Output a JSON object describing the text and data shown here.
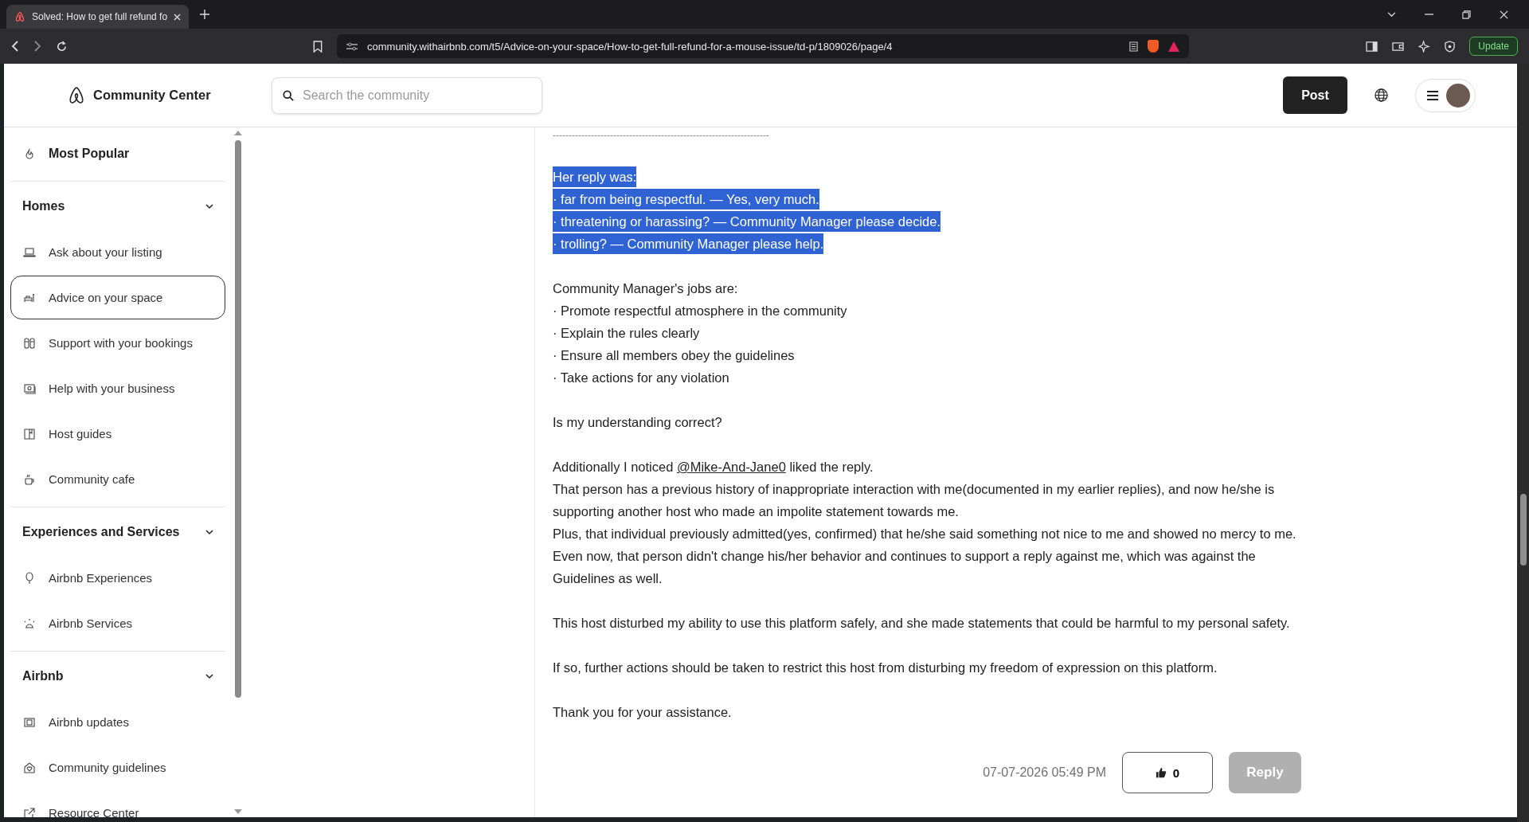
{
  "browser": {
    "tab_title": "Solved: How to get full refund fo",
    "url": "community.withairbnb.com/t5/Advice-on-your-space/How-to-get-full-refund-for-a-mouse-issue/td-p/1809026/page/4",
    "update_label": "Update"
  },
  "header": {
    "title": "Community Center",
    "search": {
      "placeholder": "Search the community"
    },
    "post_label": "Post"
  },
  "sidebar": {
    "items": [
      {
        "kind": "top-link",
        "label": "Most Popular",
        "selected": false
      },
      {
        "kind": "divider"
      },
      {
        "kind": "section",
        "label": "Homes",
        "expanded": true
      },
      {
        "kind": "link",
        "label": "Ask about your listing",
        "selected": false
      },
      {
        "kind": "link",
        "label": "Advice on your space",
        "selected": true
      },
      {
        "kind": "link",
        "label": "Support with your bookings",
        "selected": false
      },
      {
        "kind": "link",
        "label": "Help with your business",
        "selected": false
      },
      {
        "kind": "link",
        "label": "Host guides",
        "selected": false
      },
      {
        "kind": "link",
        "label": "Community cafe",
        "selected": false
      },
      {
        "kind": "divider"
      },
      {
        "kind": "section",
        "label": "Experiences and Services",
        "expanded": true
      },
      {
        "kind": "link",
        "label": "Airbnb Experiences",
        "selected": false
      },
      {
        "kind": "link",
        "label": "Airbnb Services",
        "selected": false
      },
      {
        "kind": "divider"
      },
      {
        "kind": "section",
        "label": "Airbnb",
        "expanded": true
      },
      {
        "kind": "link",
        "label": "Airbnb updates",
        "selected": false
      },
      {
        "kind": "link",
        "label": "Community guidelines",
        "selected": false
      },
      {
        "kind": "link",
        "label": "Resource Center",
        "selected": false
      }
    ]
  },
  "post": {
    "separator": "--------------------------------------------------------------------",
    "paragraphs": [
      {
        "selected": true,
        "lines": [
          [
            {
              "kind": "text",
              "text": "Her reply was:"
            }
          ],
          [
            {
              "kind": "text",
              "text": "· far from being respectful. — Yes, very much."
            }
          ],
          [
            {
              "kind": "text",
              "text": "· threatening or harassing? — Community Manager please decide."
            }
          ],
          [
            {
              "kind": "text",
              "text": "· trolling? — Community Manager please help."
            }
          ]
        ]
      },
      {
        "selected": false,
        "lines": [
          [
            {
              "kind": "text",
              "text": "Community Manager's jobs are:"
            }
          ],
          [
            {
              "kind": "text",
              "text": "· Promote respectful atmosphere in the community"
            }
          ],
          [
            {
              "kind": "text",
              "text": "· Explain the rules clearly"
            }
          ],
          [
            {
              "kind": "text",
              "text": "· Ensure all members obey the guidelines"
            }
          ],
          [
            {
              "kind": "text",
              "text": "· Take actions for any violation"
            }
          ]
        ]
      },
      {
        "selected": false,
        "lines": [
          [
            {
              "kind": "text",
              "text": "Is my understanding correct?"
            }
          ]
        ]
      },
      {
        "selected": false,
        "lines": [
          [
            {
              "kind": "text",
              "text": "Additionally I noticed "
            },
            {
              "kind": "mention",
              "text": "@Mike-And-Jane0"
            },
            {
              "kind": "text",
              "text": " liked the reply."
            }
          ],
          [
            {
              "kind": "text",
              "text": "That person has a previous history of inappropriate interaction with me(documented in my earlier replies), and now he/she is supporting another host who made an impolite statement towards me."
            }
          ],
          [
            {
              "kind": "text",
              "text": "Plus, that individual previously admitted(yes, confirmed) that he/she said something not nice to me and showed no mercy to me. Even now, that person didn't change his/her behavior and continues to support a reply against me, which was against the Guidelines as well."
            }
          ]
        ]
      },
      {
        "selected": false,
        "lines": [
          [
            {
              "kind": "text",
              "text": "This host disturbed my ability to use this platform safely, and she made statements that could be harmful to my personal safety."
            }
          ]
        ]
      },
      {
        "selected": false,
        "lines": [
          [
            {
              "kind": "text",
              "text": "If so, further actions should be taken to restrict this host from disturbing my freedom of expression on this platform."
            }
          ]
        ]
      },
      {
        "selected": false,
        "lines": [
          [
            {
              "kind": "text",
              "text": "Thank you for your assistance."
            }
          ]
        ]
      }
    ],
    "timestamp": "07-07-2026 05:49 PM",
    "likes": "0",
    "reply": {
      "label": "Reply",
      "disabled": true
    }
  }
}
